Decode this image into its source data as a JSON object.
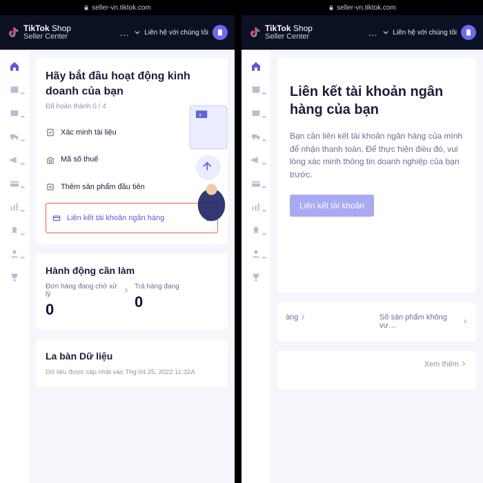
{
  "url": "seller-vn.tiktok.com",
  "brand": {
    "l1a": "TikTok",
    "l1b": "Shop",
    "l2": "Seller Center"
  },
  "header": {
    "ellipsis": "…",
    "contact": "Liên hệ với chúng tôi"
  },
  "colors": {
    "accent": "#5b5bd6",
    "hlBorder": "#f15a4a"
  },
  "left": {
    "onboard": {
      "title": "Hãy bắt đầu hoạt động kinh doanh của bạn",
      "progress": "Đã hoàn thành 0 / 4",
      "steps": {
        "verify": "Xác minh tài liệu",
        "tax": "Mã số thuế",
        "product": "Thêm sản phẩm đầu tiên",
        "bank": "Liên kết tài khoản ngân hàng"
      }
    },
    "todo": {
      "title": "Hành động cần làm",
      "a": {
        "label": "Đơn hàng đang chờ xử lý",
        "value": "0"
      },
      "b": {
        "label": "Trả hàng đang",
        "value": "0"
      }
    },
    "compass": {
      "title": "La bàn Dữ liệu",
      "updated": "Dữ liệu được cập nhật vào Thg 04 25, 2022 11:32A"
    }
  },
  "right": {
    "bank": {
      "title": "Liên kết tài khoản ngân hàng của bạn",
      "desc": "Bạn cần liên kết tài khoản ngân hàng của mình để nhận thanh toán. Để thực hiện điều đó, vui lòng xác minh thông tin doanh nghiệp của bạn trước.",
      "button": "Liên kết tài khoản"
    },
    "bottom": {
      "a": "àng",
      "b": "Số sản phẩm không vư…"
    },
    "more": "Xem thêm"
  }
}
